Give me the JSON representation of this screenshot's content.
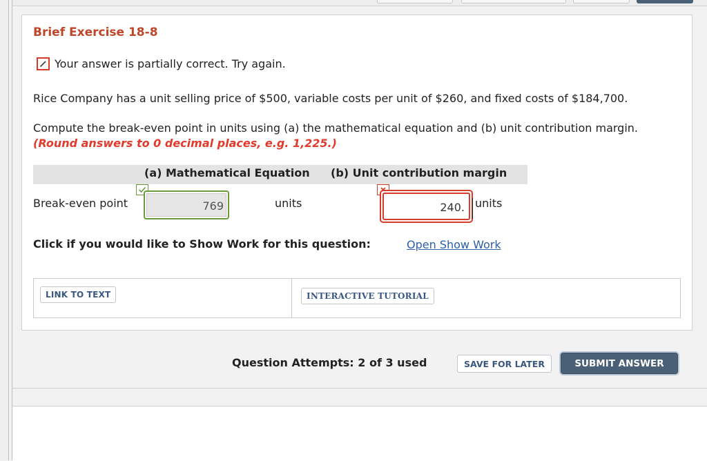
{
  "exercise": {
    "title": "Brief Exercise 18-8",
    "status_text": "Your answer is partially correct.  Try again.",
    "problem_text": "Rice Company has a unit selling price of $500, variable costs per unit of $260, and fixed costs of $184,700.",
    "instruction_text": "Compute the break-even point in units using (a) the mathematical equation and (b) unit contribution margin.",
    "rounding_note": "(Round answers to 0 decimal places, e.g. 1,225.)"
  },
  "table": {
    "col_a_header": "(a) Mathematical Equation",
    "col_b_header": "(b) Unit contribution margin",
    "row_label": "Break-even point",
    "answer_a": "769",
    "units_a": "units",
    "answer_b": "240.",
    "units_b": "units"
  },
  "show_work": {
    "prompt": "Click if you would like to Show Work for this question:",
    "link": "Open Show Work"
  },
  "resources": {
    "link_to_text": "LINK TO TEXT",
    "interactive_tutorial": "INTERACTIVE TUTORIAL"
  },
  "footer": {
    "attempts": "Question Attempts: 2 of 3 used",
    "save_label": "SAVE FOR LATER",
    "submit_label": "SUBMIT ANSWER"
  },
  "colors": {
    "title": "#c0462a",
    "incorrect": "#d83a2a",
    "correct": "#6a9a3a",
    "link": "#2c5fa8",
    "submit_bg": "#4a6077"
  }
}
